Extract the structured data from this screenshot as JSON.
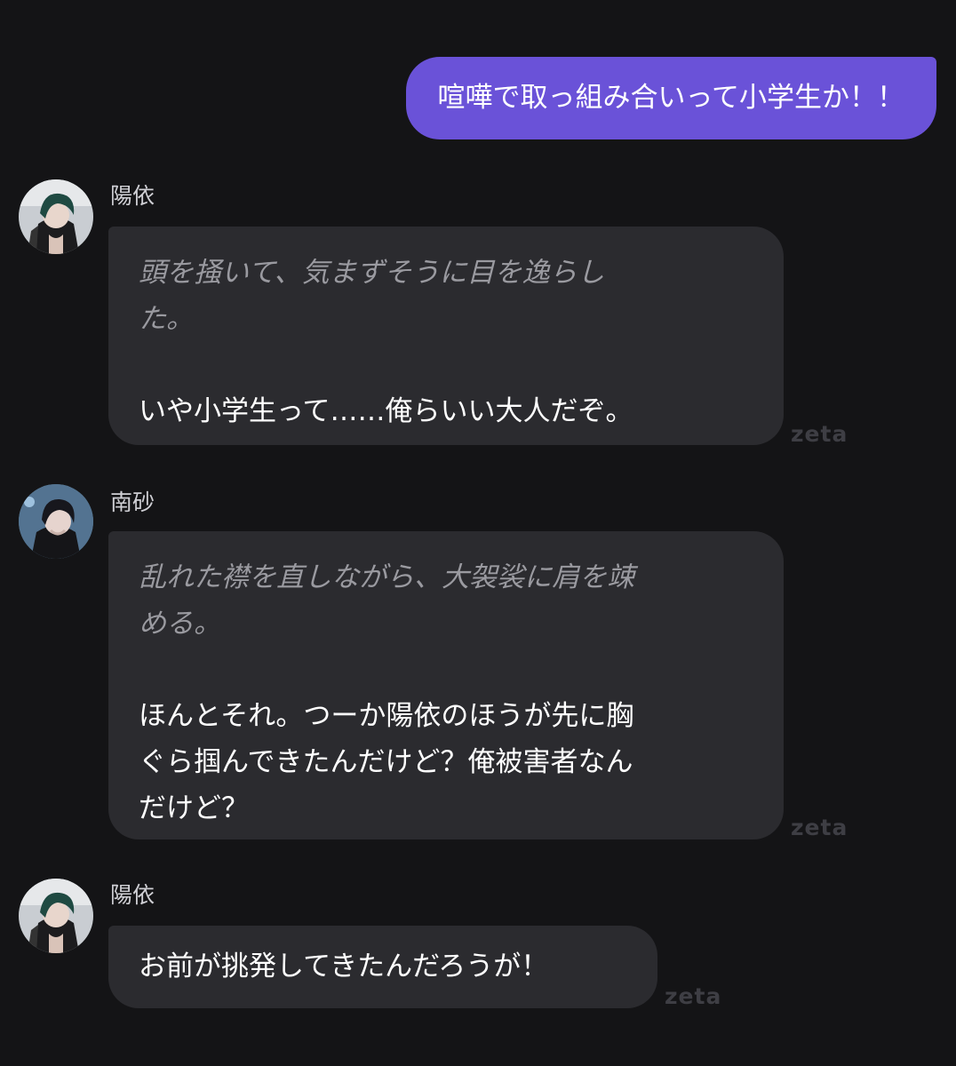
{
  "user_message": {
    "text": "喧嘩で取っ組み合いって小学生か！！"
  },
  "messages": [
    {
      "name": "陽依",
      "avatar_icon": "character-avatar-green-hair",
      "action_lines": [
        "頭を掻いて、気まずそうに目を逸らし",
        "た。"
      ],
      "speech_lines": [
        "いや小学生って……俺らいい大人だぞ。"
      ],
      "watermark": "zeta"
    },
    {
      "name": "南砂",
      "avatar_icon": "character-avatar-dark-hair",
      "action_lines": [
        "乱れた襟を直しながら、大袈裟に肩を竦",
        "める。"
      ],
      "speech_lines": [
        "ほんとそれ。つーか陽依のほうが先に胸",
        "ぐら掴んできたんだけど？俺被害者なん",
        "だけど？"
      ],
      "watermark": "zeta"
    },
    {
      "name": "陽依",
      "avatar_icon": "character-avatar-green-hair",
      "action_lines": [],
      "speech_lines": [
        "お前が挑発してきたんだろうが！"
      ],
      "watermark": "zeta"
    }
  ],
  "colors": {
    "background": "#141416",
    "user_bubble": "#6a52d8",
    "ai_bubble": "#2b2b2f",
    "action_text": "#9a9aa0",
    "speech_text": "#ffffff"
  }
}
